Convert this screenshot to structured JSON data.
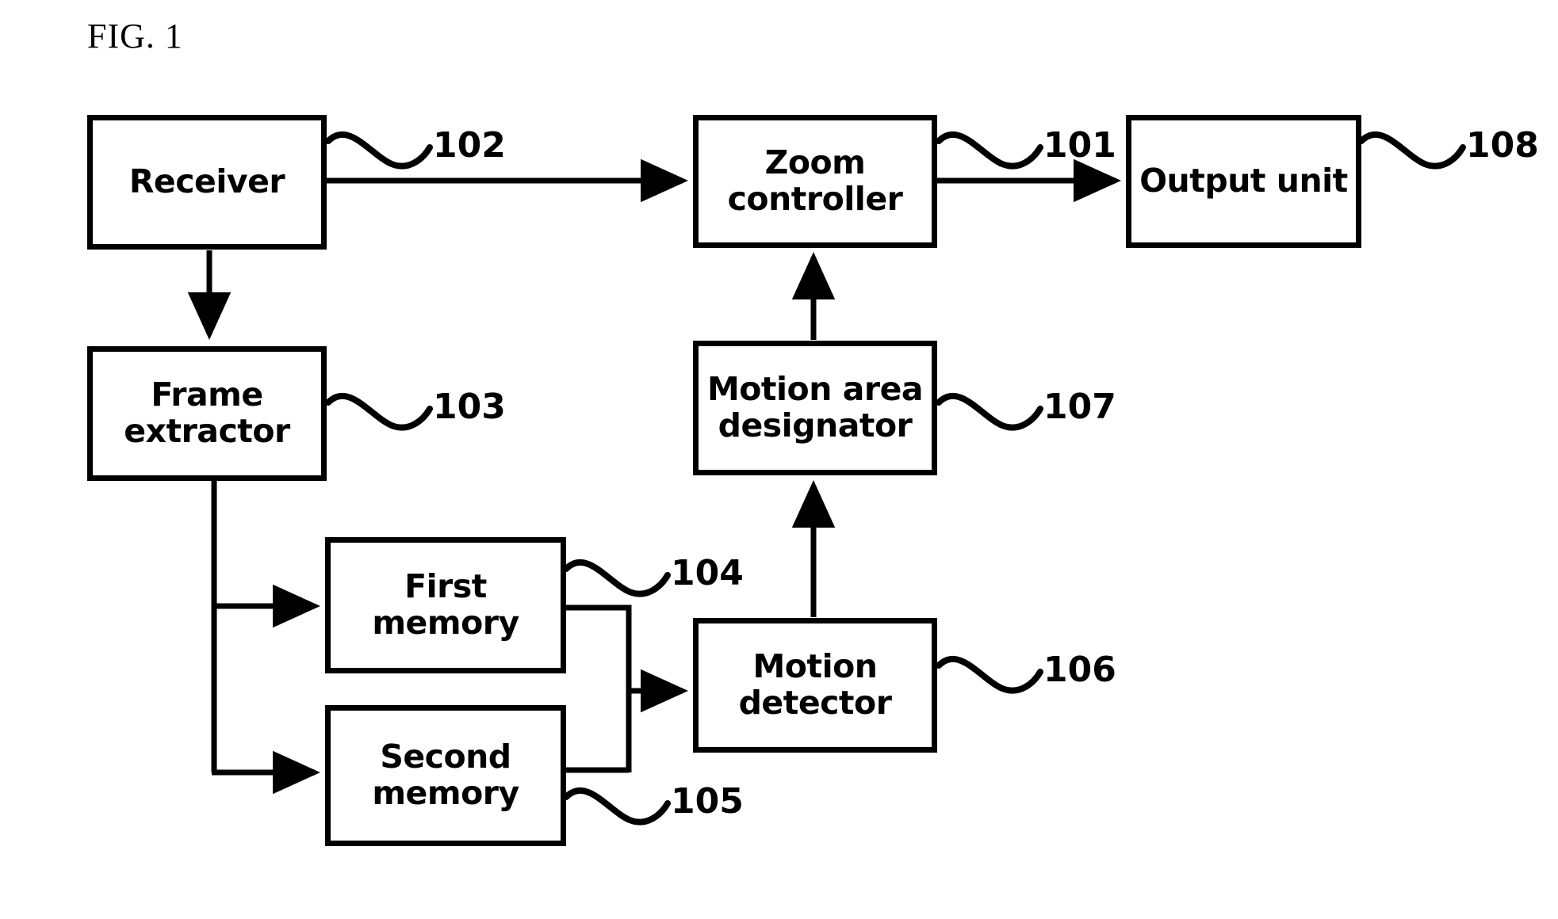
{
  "figure": {
    "title": "FIG. 1",
    "type": "patent-block-diagram"
  },
  "nodes": {
    "receiver": {
      "label": "Receiver",
      "ref": "102"
    },
    "frame_extractor": {
      "label": "Frame\nextractor",
      "ref": "103"
    },
    "first_memory": {
      "label": "First memory",
      "ref": "104"
    },
    "second_memory": {
      "label": "Second\nmemory",
      "ref": "105"
    },
    "motion_detector": {
      "label": "Motion\ndetector",
      "ref": "106"
    },
    "motion_area_designator": {
      "label": "Motion area\ndesignator",
      "ref": "107"
    },
    "zoom_controller": {
      "label": "Zoom\ncontroller",
      "ref": "101"
    },
    "output_unit": {
      "label": "Output unit",
      "ref": "108"
    }
  },
  "refs": {
    "r101": "101",
    "r102": "102",
    "r103": "103",
    "r104": "104",
    "r105": "105",
    "r106": "106",
    "r107": "107",
    "r108": "108"
  },
  "connections": [
    {
      "from": "receiver",
      "to": "zoom_controller",
      "style": "arrow"
    },
    {
      "from": "receiver",
      "to": "frame_extractor",
      "style": "arrow"
    },
    {
      "from": "frame_extractor",
      "to": "first_memory",
      "style": "arrow"
    },
    {
      "from": "frame_extractor",
      "to": "second_memory",
      "style": "arrow"
    },
    {
      "from": "first_memory",
      "to": "motion_detector",
      "style": "arrow"
    },
    {
      "from": "second_memory",
      "to": "motion_detector",
      "style": "arrow"
    },
    {
      "from": "motion_detector",
      "to": "motion_area_designator",
      "style": "arrow"
    },
    {
      "from": "motion_area_designator",
      "to": "zoom_controller",
      "style": "arrow"
    },
    {
      "from": "zoom_controller",
      "to": "output_unit",
      "style": "arrow"
    }
  ],
  "colors": {
    "stroke": "#000000",
    "background": "#ffffff"
  }
}
